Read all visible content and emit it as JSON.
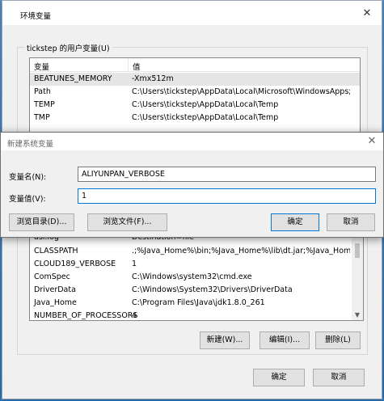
{
  "env_dialog": {
    "title": "环境变量",
    "close_glyph": "✕",
    "user_vars": {
      "label": "tickstep 的用户变量(U)",
      "col_variable": "变量",
      "col_value": "值",
      "rows": [
        {
          "name": "BEATUNES_MEMORY",
          "value": "-Xmx512m"
        },
        {
          "name": "Path",
          "value": "C:\\Users\\tickstep\\AppData\\Local\\Microsoft\\WindowsApps;C:..."
        },
        {
          "name": "TEMP",
          "value": "C:\\Users\\tickstep\\AppData\\Local\\Temp"
        },
        {
          "name": "TMP",
          "value": "C:\\Users\\tickstep\\AppData\\Local\\Temp"
        }
      ]
    },
    "sys_vars": {
      "rows": [
        {
          "name": "asl.log",
          "value": "Destination=file"
        },
        {
          "name": "CLASSPATH",
          "value": ".;%Java_Home%\\bin;%Java_Home%\\lib\\dt.jar;%Java_Home%\\..."
        },
        {
          "name": "CLOUD189_VERBOSE",
          "value": "1"
        },
        {
          "name": "ComSpec",
          "value": "C:\\Windows\\system32\\cmd.exe"
        },
        {
          "name": "DriverData",
          "value": "C:\\Windows\\System32\\Drivers\\DriverData"
        },
        {
          "name": "Java_Home",
          "value": "C:\\Program Files\\Java\\jdk1.8.0_261"
        },
        {
          "name": "NUMBER_OF_PROCESSORS",
          "value": "4"
        }
      ],
      "new_button": "新建(W)...",
      "edit_button": "编辑(I)...",
      "delete_button": "删除(L)"
    },
    "ok_button": "确定",
    "cancel_button": "取消"
  },
  "new_var_dialog": {
    "title": "新建系统变量",
    "close_glyph": "✕",
    "name_label": "变量名(N):",
    "name_value": "ALIYUNPAN_VERBOSE",
    "value_label": "变量值(V):",
    "value_value": "1",
    "browse_dir_button": "浏览目录(D)...",
    "browse_file_button": "浏览文件(F)...",
    "ok_button": "确定",
    "cancel_button": "取消"
  }
}
